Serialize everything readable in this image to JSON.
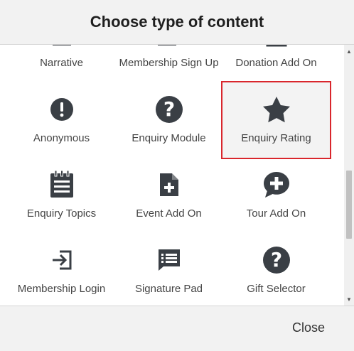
{
  "dialog": {
    "title": "Choose type of content",
    "close_label": "Close"
  },
  "tiles": [
    {
      "label": "Narrative",
      "icon": "document-icon"
    },
    {
      "label": "Membership Sign Up",
      "icon": "add-gallery-icon"
    },
    {
      "label": "Donation Add On",
      "icon": "dollar-clipboard-icon"
    },
    {
      "label": "Anonymous",
      "icon": "exclamation-circle-icon"
    },
    {
      "label": "Enquiry Module",
      "icon": "question-circle-icon"
    },
    {
      "label": "Enquiry Rating",
      "icon": "star-icon",
      "selected": true
    },
    {
      "label": "Enquiry Topics",
      "icon": "notepad-icon"
    },
    {
      "label": "Event Add On",
      "icon": "file-plus-icon"
    },
    {
      "label": "Tour Add On",
      "icon": "plus-speech-bubble-icon"
    },
    {
      "label": "Membership Login",
      "icon": "sign-in-icon"
    },
    {
      "label": "Signature Pad",
      "icon": "message-lines-icon"
    },
    {
      "label": "Gift Selector",
      "icon": "question-circle-icon"
    }
  ],
  "colors": {
    "icon": "#3a3f45",
    "selected_border": "#d9262c",
    "selected_bg": "#f3f3f3"
  }
}
